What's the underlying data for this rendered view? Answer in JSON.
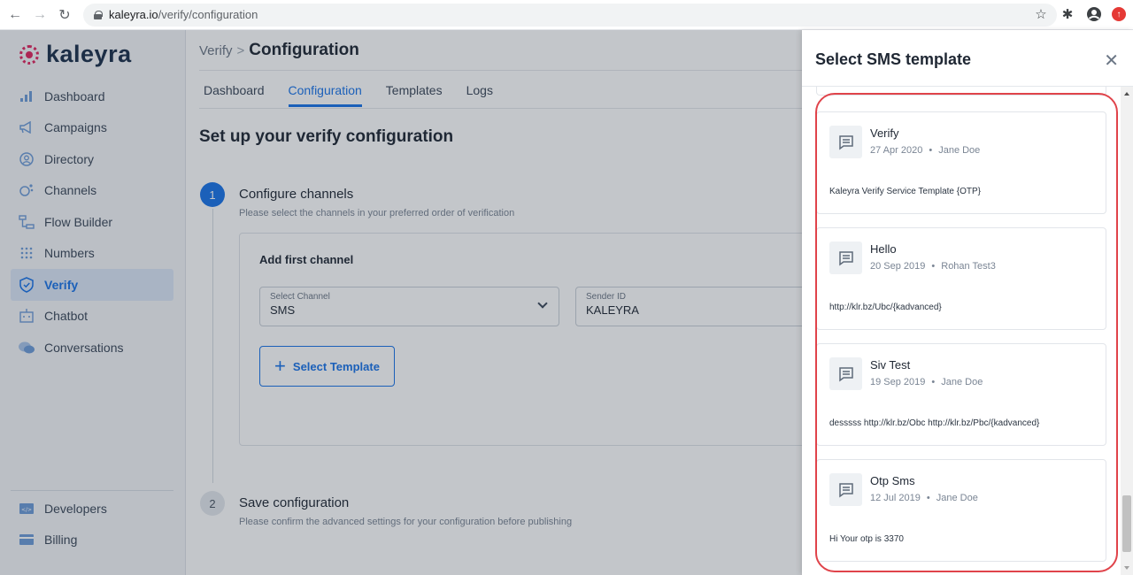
{
  "browser": {
    "url_host": "kaleyra.io",
    "url_path": "/verify/configuration"
  },
  "brand": {
    "name": "kaleyra",
    "accent": "#1a73e8",
    "logo_color": "#e0245e"
  },
  "sidebar": {
    "items": [
      {
        "label": "Dashboard",
        "icon": "bar-chart-icon"
      },
      {
        "label": "Campaigns",
        "icon": "megaphone-icon"
      },
      {
        "label": "Directory",
        "icon": "contact-icon"
      },
      {
        "label": "Channels",
        "icon": "channels-icon"
      },
      {
        "label": "Flow Builder",
        "icon": "flow-icon"
      },
      {
        "label": "Numbers",
        "icon": "dialpad-icon"
      },
      {
        "label": "Verify",
        "icon": "shield-check-icon",
        "active": true
      },
      {
        "label": "Chatbot",
        "icon": "robot-icon"
      },
      {
        "label": "Conversations",
        "icon": "chat-bubbles-icon"
      }
    ],
    "bottom_items": [
      {
        "label": "Developers",
        "icon": "code-icon"
      },
      {
        "label": "Billing",
        "icon": "card-icon"
      }
    ]
  },
  "main": {
    "breadcrumb_parent": "Verify",
    "breadcrumb_current": "Configuration",
    "tabs": [
      "Dashboard",
      "Configuration",
      "Templates",
      "Logs"
    ],
    "active_tab": "Configuration",
    "page_title": "Set up your verify configuration",
    "step1": {
      "number": "1",
      "title": "Configure channels",
      "subtitle": "Please select the channels in your preferred order of verification",
      "card_title": "Add first channel",
      "select_channel_label": "Select Channel",
      "select_channel_value": "SMS",
      "sender_id_label": "Sender ID",
      "sender_id_value": "KALEYRA",
      "select_template_label": "Select Template"
    },
    "step2": {
      "number": "2",
      "title": "Save configuration",
      "subtitle": "Please confirm the advanced settings for your configuration before publishing"
    }
  },
  "drawer": {
    "title": "Select SMS template",
    "close": "✕",
    "templates": [
      {
        "name": "Verify",
        "date": "27 Apr 2020",
        "author": "Jane Doe",
        "body": "Kaleyra Verify Service Template {OTP}"
      },
      {
        "name": "Hello",
        "date": "20 Sep 2019",
        "author": "Rohan Test3",
        "body": "http://klr.bz/Ubc/{kadvanced}"
      },
      {
        "name": "Siv Test",
        "date": "19 Sep 2019",
        "author": "Jane Doe",
        "body": "desssss http://klr.bz/Obc http://klr.bz/Pbc/{kadvanced}"
      },
      {
        "name": "Otp Sms",
        "date": "12 Jul 2019",
        "author": "Jane Doe",
        "body": "Hi Your otp is 3370"
      }
    ],
    "highlight_color": "#e0434a"
  }
}
